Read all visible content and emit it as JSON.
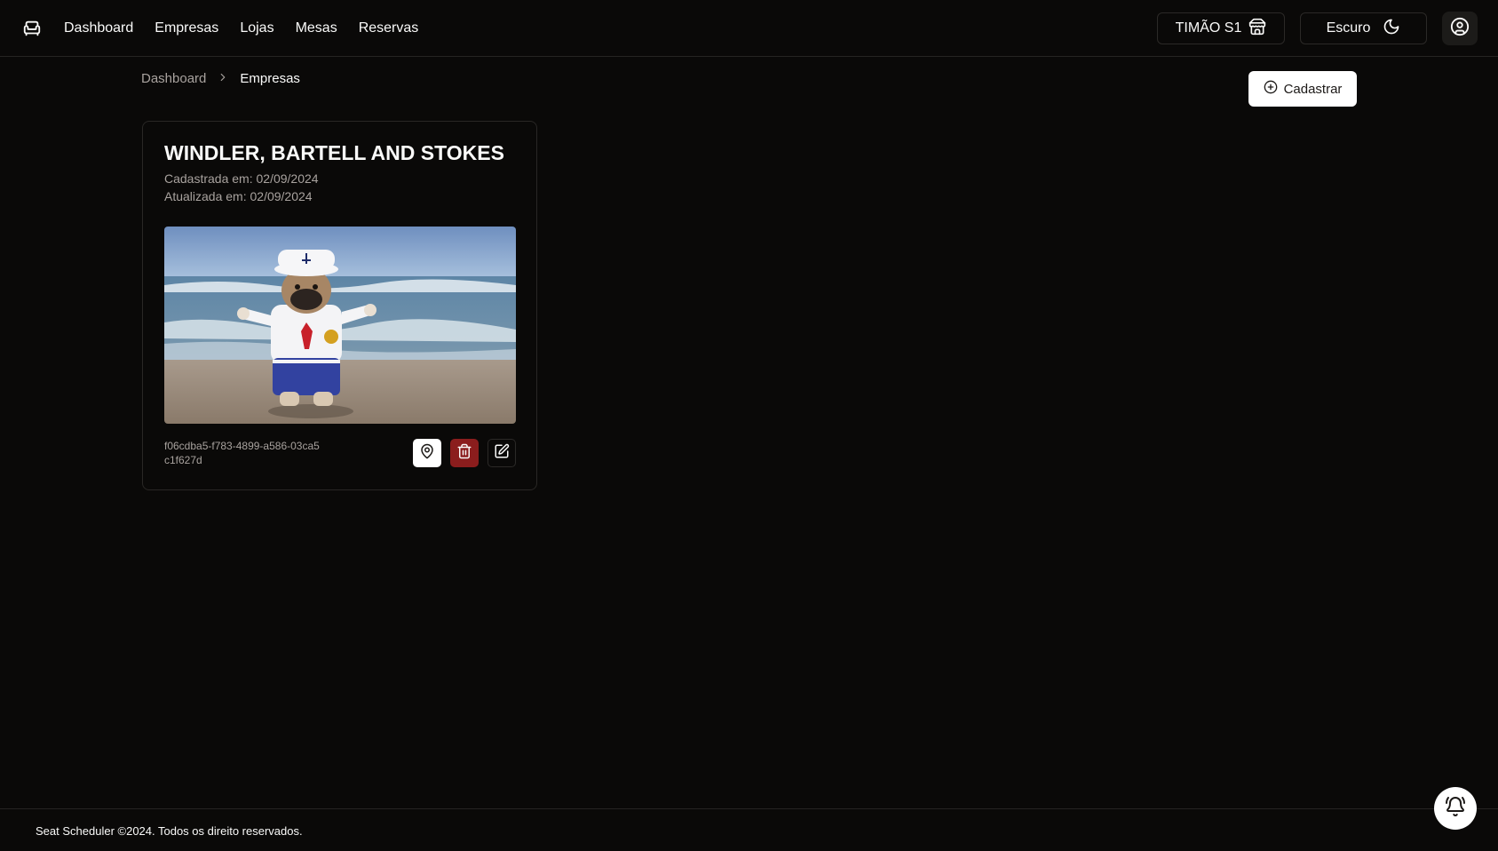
{
  "nav": {
    "logo_icon": "armchair-icon",
    "items": [
      {
        "label": "Dashboard"
      },
      {
        "label": "Empresas"
      },
      {
        "label": "Lojas"
      },
      {
        "label": "Mesas"
      },
      {
        "label": "Reservas"
      }
    ]
  },
  "header": {
    "store_label": "TIMÃO S1",
    "store_icon": "store-icon",
    "theme_label": "Escuro",
    "theme_icon": "moon-icon",
    "user_icon": "user-circle-icon"
  },
  "breadcrumb": {
    "items": [
      "Dashboard",
      "Empresas"
    ],
    "separator_icon": "chevron-right-icon"
  },
  "actions": {
    "register_label": "Cadastrar",
    "register_icon": "plus-circle-icon"
  },
  "company_card": {
    "name": "WINDLER, BARTELL AND STOKES",
    "created": "Cadastrada em: 02/09/2024",
    "updated": "Atualizada em: 02/09/2024",
    "image_alt": "bulldog in sailor costume on beach",
    "id": "f06cdba5-f783-4899-a586-03ca5c1f627d",
    "buttons": [
      "map-pin-icon",
      "trash-icon",
      "edit-icon"
    ]
  },
  "footer": {
    "text": "Seat Scheduler ©2024. Todos os direito reservados.",
    "bell_icon": "bell-ring-icon"
  },
  "colors": {
    "background": "#0a0908",
    "danger": "#8b1d1d",
    "primary_button": "#ffffff"
  }
}
